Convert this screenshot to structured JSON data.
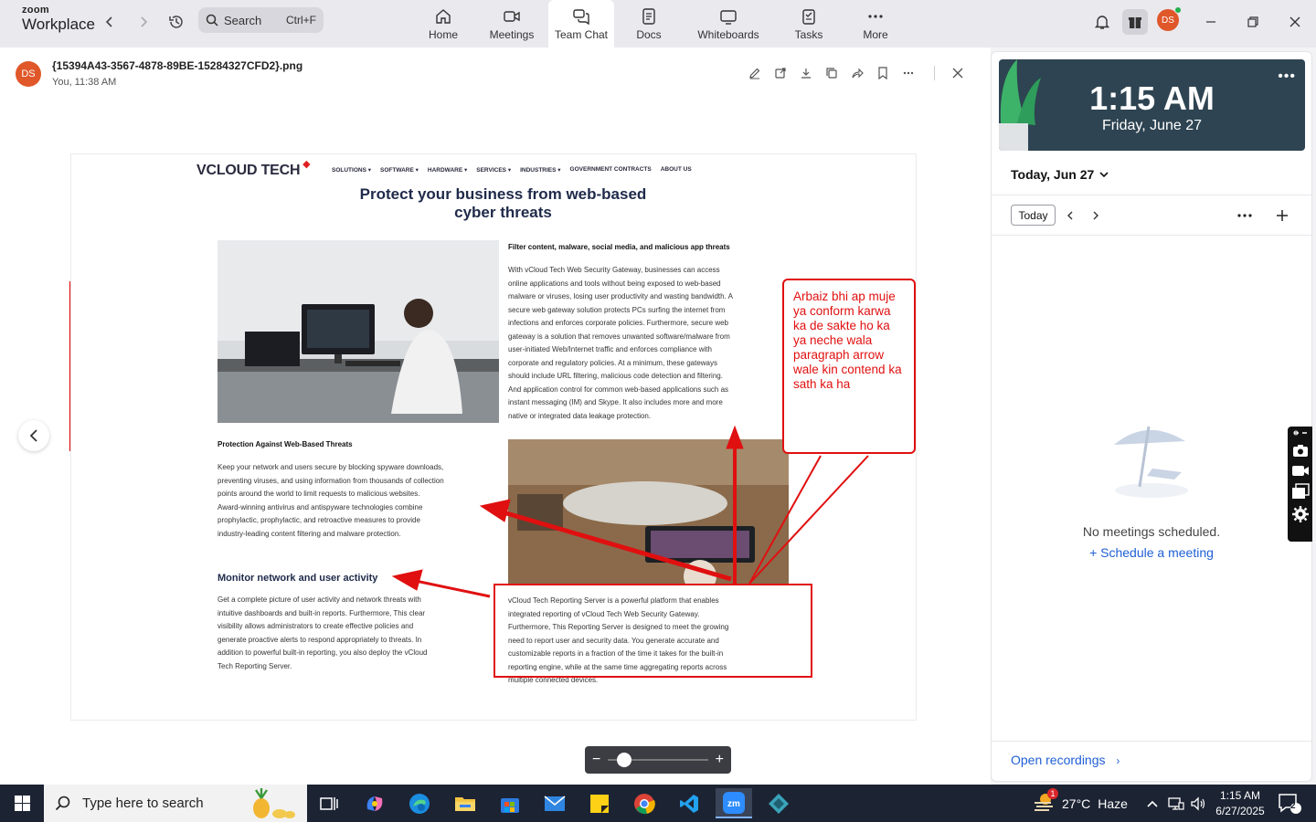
{
  "app": {
    "brand_top": "zoom",
    "brand_bottom": "Workplace",
    "search_placeholder": "Search",
    "search_shortcut": "Ctrl+F",
    "tabs": [
      {
        "label": "Home",
        "icon": "home-icon"
      },
      {
        "label": "Meetings",
        "icon": "video-camera-icon"
      },
      {
        "label": "Team Chat",
        "icon": "chat-bubbles-icon",
        "active": true
      },
      {
        "label": "Docs",
        "icon": "document-icon"
      },
      {
        "label": "Whiteboards",
        "icon": "whiteboard-icon"
      },
      {
        "label": "Tasks",
        "icon": "tasks-icon"
      },
      {
        "label": "More",
        "icon": "more-dots-icon"
      }
    ],
    "user_initials": "DS"
  },
  "viewer": {
    "file_name": "{15394A43-3567-4878-89BE-15284327CFD2}.png",
    "file_meta": "You, 11:38 AM",
    "sender_initials": "DS"
  },
  "doc": {
    "logo": "VCLOUD TECH",
    "nav": [
      "SOLUTIONS ▾",
      "SOFTWARE ▾",
      "HARDWARE ▾",
      "SERVICES ▾",
      "INDUSTRIES ▾",
      "GOVERNMENT CONTRACTS",
      "ABOUT US"
    ],
    "title_line1": "Protect your business from web-based",
    "title_line2": "cyber threats",
    "section1_heading": "Filter content, malware, social media, and malicious app threats",
    "section1_lines": [
      "With vCloud Tech Web Security Gateway, businesses can access",
      "online applications and tools without being exposed to web-based",
      "malware or viruses, losing user productivity and wasting bandwidth. A",
      "secure web gateway solution protects PCs surfing the internet from",
      "infections and enforces corporate policies. Furthermore,  secure web",
      "gateway is a solution that removes unwanted software/malware from",
      "user-initiated Web/Internet traffic and enforces compliance with",
      "corporate and regulatory policies. At a minimum, these gateways",
      "should include URL filtering, malicious code detection and filtering.",
      "And application control for common web-based applications such as",
      "instant messaging (IM) and Skype. It also includes more and more",
      "native or integrated data leakage protection."
    ],
    "section2_heading": "Protection Against Web-Based Threats",
    "section2_lines": [
      "Keep your network and users secure by blocking spyware downloads,",
      "preventing viruses, and using information from thousands of collection",
      "points around the world to limit requests to malicious websites.",
      "Award-winning antivirus and antispyware technologies combine",
      "prophylactic, prophylactic, and retroactive measures to provide",
      "industry-leading content filtering and malware protection."
    ],
    "section3_heading": "Monitor network and user activity",
    "section3_lines": [
      "Get a complete picture of user activity and network threats with",
      "intuitive dashboards and built-in reports. Furthermore, This clear",
      "visibility allows administrators to create effective policies and",
      "generate proactive alerts to respond appropriately to threats. In",
      "addition to powerful built-in reporting, you also deploy the vCloud",
      "Tech Reporting Server."
    ],
    "section4_lines": [
      "vCloud Tech Reporting Server is a powerful platform that enables",
      "integrated reporting of vCloud Tech Web Security Gateway.",
      "Furthermore, This Reporting Server is designed to meet the growing",
      "need to report user and security data. You generate accurate and",
      "customizable reports in a fraction of the time it takes for the built-in",
      "reporting engine, while at the same time aggregating reports across",
      "multiple connected devices."
    ],
    "annotation_note": "Arbaiz bhi ap muje ya conform karwa ka de sakte ho ka ya neche wala paragraph arrow wale kin contend ka sath ka ha",
    "annotation_color": "#e01010"
  },
  "zoom": {
    "level": 0.1
  },
  "calendar": {
    "time": "1:15 AM",
    "date": "Friday, June 27",
    "day_selector": "Today, Jun 27",
    "today_button": "Today",
    "empty_text": "No meetings scheduled.",
    "schedule_link": "+ Schedule a meeting",
    "open_recordings": "Open recordings",
    "accent": "#1f5fd6"
  },
  "taskbar": {
    "search_placeholder": "Type here to search",
    "weather_temp": "27°C",
    "weather_desc": "Haze",
    "weather_badge": "1",
    "time": "1:15 AM",
    "date": "6/27/2025",
    "notification_count": "2"
  }
}
